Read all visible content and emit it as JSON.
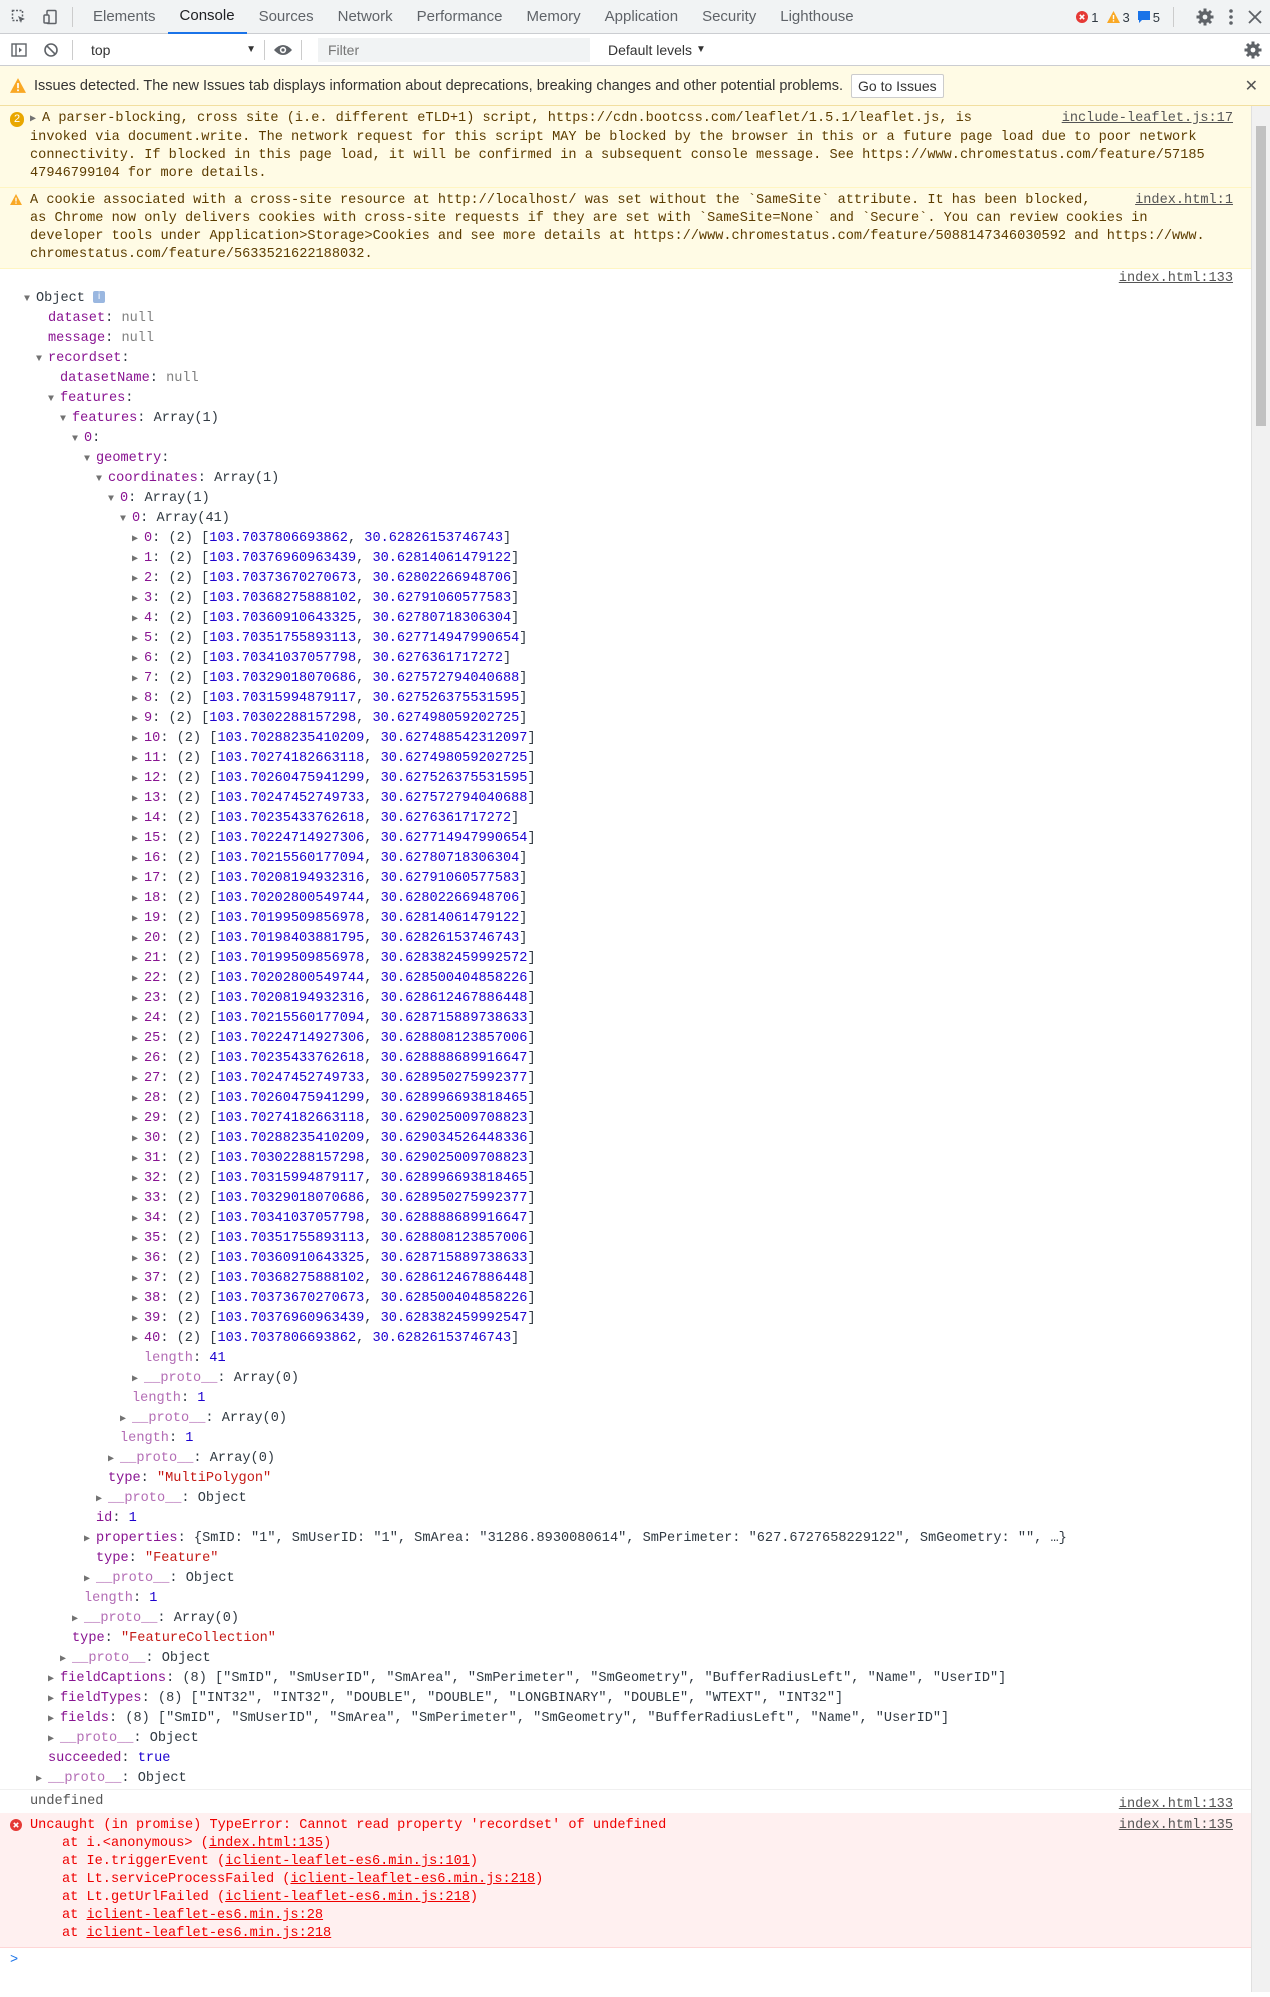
{
  "toolbar": {
    "tabs": [
      "Elements",
      "Console",
      "Sources",
      "Network",
      "Performance",
      "Memory",
      "Application",
      "Security",
      "Lighthouse"
    ],
    "active_tab": "Console",
    "errors_count": "1",
    "warnings_count": "3",
    "messages_count": "5"
  },
  "filterbar": {
    "context": "top",
    "filter_placeholder": "Filter",
    "levels": "Default levels"
  },
  "issues_banner": {
    "text": "Issues detected. The new Issues tab displays information about deprecations, breaking changes and other potential problems.",
    "button": "Go to Issues"
  },
  "warnings": [
    {
      "count": "2",
      "lines": [
        "A parser-blocking, cross site (i.e. different eTLD+1) script, https://cdn.bootcss.com/leaflet/1.5.1/leaflet.js, is",
        "invoked via document.write. The network request for this script MAY be blocked by the browser in this or a future page load due to poor network",
        "connectivity. If blocked in this page load, it will be confirmed in a subsequent console message. See https://www.chromestatus.com/feature/57185",
        "47946799104 for more details."
      ],
      "source": "include-leaflet.js:17"
    },
    {
      "lines": [
        "A cookie associated with a cross-site resource at http://localhost/ was set without the `SameSite` attribute. It has been blocked,",
        "as Chrome now only delivers cookies with cross-site requests if they are set with `SameSite=None` and `Secure`. You can review cookies in",
        "developer tools under Application>Storage>Cookies and see more details at https://www.chromestatus.com/feature/5088147346030592 and https://www.",
        "chromestatus.com/feature/5633521622188032."
      ],
      "source": "index.html:1"
    }
  ],
  "object_log": {
    "source": "index.html:133",
    "object_label": "Object",
    "dataset": "null",
    "message": "null",
    "datasetName": "null",
    "features_array": "Array(1)",
    "coordinates_array": "Array(1)",
    "ring_array": "Array(1)",
    "points_array": "Array(41)",
    "points": [
      [
        "103.7037806693862",
        "30.62826153746743"
      ],
      [
        "103.70376960963439",
        "30.62814061479122"
      ],
      [
        "103.70373670270673",
        "30.62802266948706"
      ],
      [
        "103.70368275888102",
        "30.62791060577583"
      ],
      [
        "103.70360910643325",
        "30.62780718306304"
      ],
      [
        "103.70351755893113",
        "30.627714947990654"
      ],
      [
        "103.70341037057798",
        "30.6276361717272"
      ],
      [
        "103.70329018070686",
        "30.627572794040688"
      ],
      [
        "103.70315994879117",
        "30.627526375531595"
      ],
      [
        "103.70302288157298",
        "30.627498059202725"
      ],
      [
        "103.70288235410209",
        "30.627488542312097"
      ],
      [
        "103.70274182663118",
        "30.627498059202725"
      ],
      [
        "103.70260475941299",
        "30.627526375531595"
      ],
      [
        "103.70247452749733",
        "30.627572794040688"
      ],
      [
        "103.70235433762618",
        "30.6276361717272"
      ],
      [
        "103.70224714927306",
        "30.627714947990654"
      ],
      [
        "103.70215560177094",
        "30.62780718306304"
      ],
      [
        "103.70208194932316",
        "30.62791060577583"
      ],
      [
        "103.70202800549744",
        "30.62802266948706"
      ],
      [
        "103.70199509856978",
        "30.62814061479122"
      ],
      [
        "103.70198403881795",
        "30.62826153746743"
      ],
      [
        "103.70199509856978",
        "30.628382459992572"
      ],
      [
        "103.70202800549744",
        "30.628500404858226"
      ],
      [
        "103.70208194932316",
        "30.628612467886448"
      ],
      [
        "103.70215560177094",
        "30.628715889738633"
      ],
      [
        "103.70224714927306",
        "30.628808123857006"
      ],
      [
        "103.70235433762618",
        "30.628888689916647"
      ],
      [
        "103.70247452749733",
        "30.628950275992377"
      ],
      [
        "103.70260475941299",
        "30.628996693818465"
      ],
      [
        "103.70274182663118",
        "30.629025009708823"
      ],
      [
        "103.70288235410209",
        "30.629034526448336"
      ],
      [
        "103.70302288157298",
        "30.629025009708823"
      ],
      [
        "103.70315994879117",
        "30.628996693818465"
      ],
      [
        "103.70329018070686",
        "30.628950275992377"
      ],
      [
        "103.70341037057798",
        "30.628888689916647"
      ],
      [
        "103.70351755893113",
        "30.628808123857006"
      ],
      [
        "103.70360910643325",
        "30.628715889738633"
      ],
      [
        "103.70368275888102",
        "30.628612467886448"
      ],
      [
        "103.70373670270673",
        "30.628500404858226"
      ],
      [
        "103.70376960963439",
        "30.628382459992547"
      ],
      [
        "103.7037806693862",
        "30.62826153746743"
      ]
    ],
    "points_length": "41",
    "empty_array": "Array(0)",
    "ring_length": "1",
    "coords_length": "1",
    "geometry_type": "\"MultiPolygon\"",
    "proto_object": "Object",
    "feature_id": "1",
    "properties_preview": "{SmID: \"1\", SmUserID: \"1\", SmArea: \"31286.8930080614\", SmPerimeter: \"627.6727658229122\", SmGeometry: \"\", …}",
    "feature_type": "\"Feature\"",
    "features_length": "1",
    "collection_type": "\"FeatureCollection\"",
    "fieldCaptions": "(8) [\"SmID\", \"SmUserID\", \"SmArea\", \"SmPerimeter\", \"SmGeometry\", \"BufferRadiusLeft\", \"Name\", \"UserID\"]",
    "fieldTypes": "(8) [\"INT32\", \"INT32\", \"DOUBLE\", \"DOUBLE\", \"LONGBINARY\", \"DOUBLE\", \"WTEXT\", \"INT32\"]",
    "fields": "(8) [\"SmID\", \"SmUserID\", \"SmArea\", \"SmPerimeter\", \"SmGeometry\", \"BufferRadiusLeft\", \"Name\", \"UserID\"]",
    "succeeded": "true"
  },
  "undefined_log": {
    "text": "undefined",
    "source": "index.html:133"
  },
  "error_log": {
    "message": "Uncaught (in promise) TypeError: Cannot read property 'recordset' of undefined",
    "source": "index.html:135",
    "stack": [
      {
        "prefix": "at i.<anonymous> (",
        "link": "index.html:135",
        "suffix": ")"
      },
      {
        "prefix": "at Ie.triggerEvent (",
        "link": "iclient-leaflet-es6.min.js:101",
        "suffix": ")"
      },
      {
        "prefix": "at Lt.serviceProcessFailed (",
        "link": "iclient-leaflet-es6.min.js:218",
        "suffix": ")"
      },
      {
        "prefix": "at Lt.getUrlFailed (",
        "link": "iclient-leaflet-es6.min.js:218",
        "suffix": ")"
      },
      {
        "prefix": "at ",
        "link": "iclient-leaflet-es6.min.js:28",
        "suffix": ""
      },
      {
        "prefix": "at ",
        "link": "iclient-leaflet-es6.min.js:218",
        "suffix": ""
      }
    ]
  },
  "prompt": ">",
  "colors": {
    "accent": "#1a73e8",
    "warning_bg": "#fffbe5",
    "error_bg": "#fff0f0",
    "error_text": "#e00000",
    "key_purple": "#881391",
    "number_blue": "#1c00cf",
    "string_red": "#c41a16"
  },
  "icons": [
    "inspect-icon",
    "device-toggle-icon",
    "error-icon",
    "warning-icon",
    "message-icon",
    "settings-icon",
    "more-icon",
    "close-icon",
    "sidebar-icon",
    "clear-icon",
    "eye-icon",
    "console-settings-icon"
  ]
}
